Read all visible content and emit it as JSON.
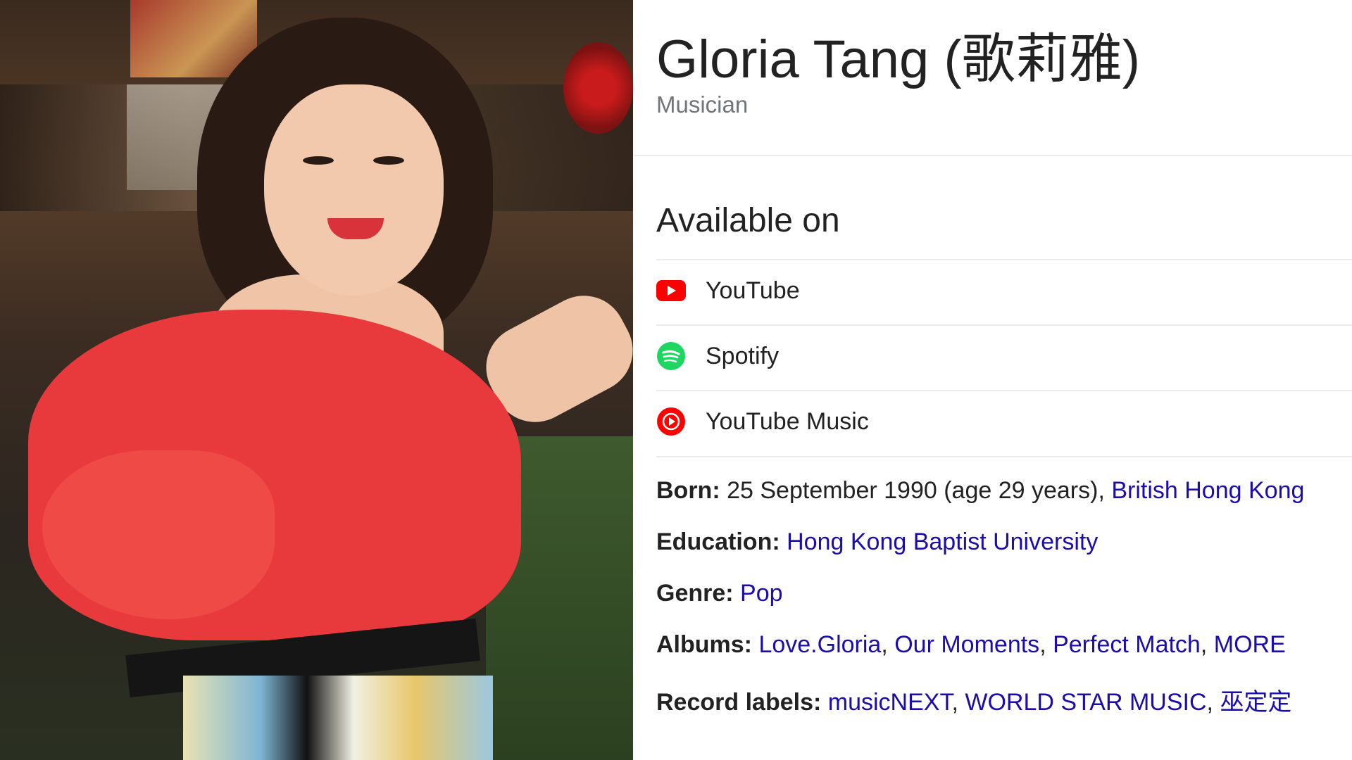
{
  "photo": {
    "alt": ""
  },
  "entity": {
    "name": "Gloria Tang (歌莉雅)",
    "type": "Musician"
  },
  "available": {
    "heading": "Available on",
    "providers": [
      {
        "label": "YouTube",
        "icon": "youtube-icon",
        "color": "#ff0000"
      },
      {
        "label": "Spotify",
        "icon": "spotify-icon",
        "color": "#1ed760"
      },
      {
        "label": "YouTube Music",
        "icon": "youtube-music-icon",
        "color": "#ff0000"
      }
    ]
  },
  "facts": {
    "born": {
      "key": "Born:",
      "value": "25 September 1990 (age 29 years),",
      "link": "British Hong Kong"
    },
    "education": {
      "key": "Education:",
      "link": "Hong Kong Baptist University"
    },
    "genre": {
      "key": "Genre:",
      "link": "Pop"
    },
    "albums": {
      "key": "Albums:",
      "links": [
        "Love.Gloria",
        "Our Moments",
        "Perfect Match",
        "MORE"
      ],
      "sep": ", "
    },
    "labels": {
      "key": "Record labels:",
      "links": [
        "musicNEXT",
        "WORLD STAR MUSIC",
        "巫定定"
      ],
      "sep": ", "
    }
  },
  "colors": {
    "link": "#1a0dab",
    "text": "#222222",
    "muted": "#70757a",
    "divider": "#ebebeb"
  }
}
